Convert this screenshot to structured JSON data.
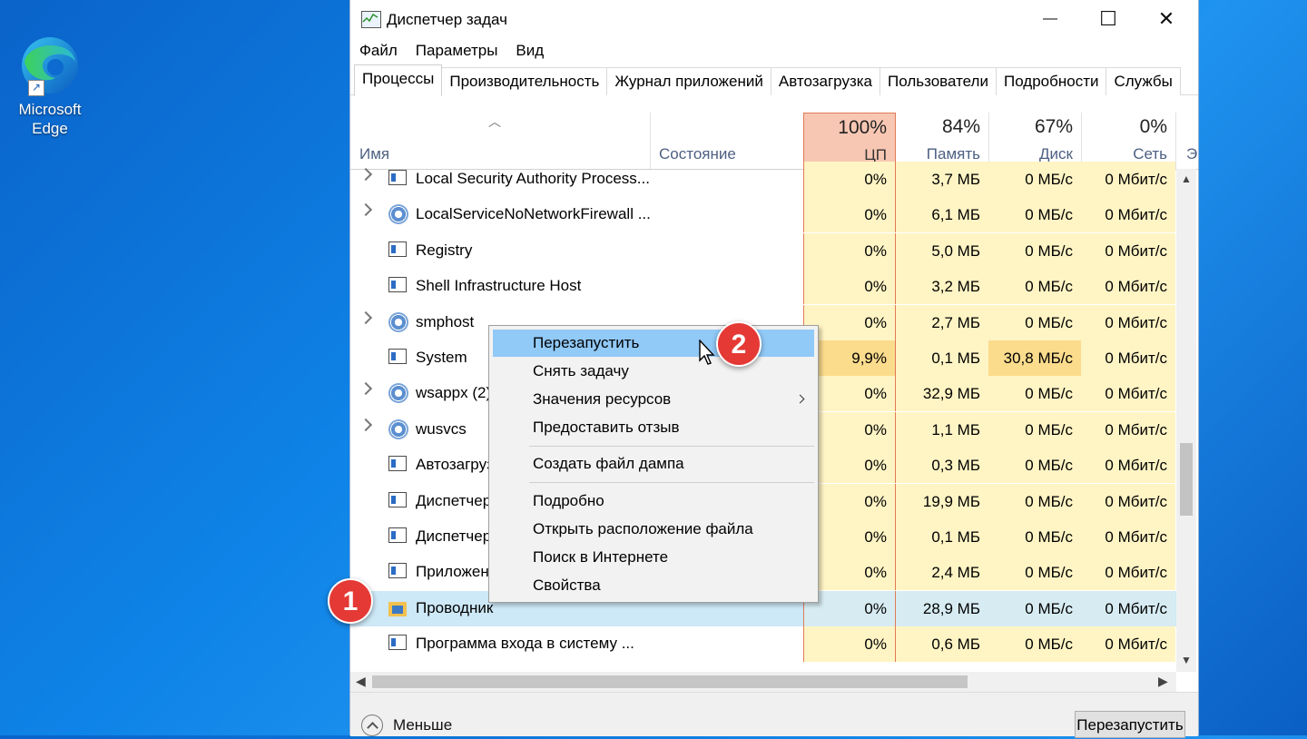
{
  "desktop": {
    "edge_label_line1": "Microsoft",
    "edge_label_line2": "Edge"
  },
  "window": {
    "title": "Диспетчер задач",
    "controls": {
      "minimize": "—",
      "maximize": "☐",
      "close": "✕"
    },
    "menu": [
      "Файл",
      "Параметры",
      "Вид"
    ],
    "tabs": [
      "Процессы",
      "Производительность",
      "Журнал приложений",
      "Автозагрузка",
      "Пользователи",
      "Подробности",
      "Службы"
    ],
    "active_tab": 0
  },
  "table": {
    "col_name": "Имя",
    "col_state": "Состояние",
    "cpu": {
      "pct": "100%",
      "label": "ЦП"
    },
    "mem": {
      "pct": "84%",
      "label": "Память"
    },
    "disk": {
      "pct": "67%",
      "label": "Диск"
    },
    "net": {
      "pct": "0%",
      "label": "Сеть"
    },
    "col_more": "Э",
    "rows": [
      {
        "name": "Local Security Authority Process...",
        "icon": "window",
        "expand": true,
        "cpu": "0%",
        "mem": "3,7 МБ",
        "disk": "0 МБ/с",
        "net": "0 Мбит/с"
      },
      {
        "name": "LocalServiceNoNetworkFirewall ...",
        "icon": "gear",
        "expand": true,
        "cpu": "0%",
        "mem": "6,1 МБ",
        "disk": "0 МБ/с",
        "net": "0 Мбит/с"
      },
      {
        "name": "Registry",
        "icon": "window",
        "expand": false,
        "cpu": "0%",
        "mem": "5,0 МБ",
        "disk": "0 МБ/с",
        "net": "0 Мбит/с"
      },
      {
        "name": "Shell Infrastructure Host",
        "icon": "window",
        "expand": false,
        "cpu": "0%",
        "mem": "3,2 МБ",
        "disk": "0 МБ/с",
        "net": "0 Мбит/с"
      },
      {
        "name": "smphost",
        "icon": "gear",
        "expand": true,
        "cpu": "0%",
        "mem": "2,7 МБ",
        "disk": "0 МБ/с",
        "net": "0 Мбит/с"
      },
      {
        "name": "System",
        "icon": "window",
        "expand": false,
        "cpu": "9,9%",
        "mem": "0,1 МБ",
        "disk": "30,8 МБ/с",
        "net": "0 Мбит/с",
        "hot_cpu": true,
        "hot_disk": true
      },
      {
        "name": "wsappx (2)",
        "icon": "gear",
        "expand": true,
        "cpu": "0%",
        "mem": "32,9 МБ",
        "disk": "0 МБ/с",
        "net": "0 Мбит/с"
      },
      {
        "name": "wusvcs",
        "icon": "gear",
        "expand": true,
        "cpu": "0%",
        "mem": "1,1 МБ",
        "disk": "0 МБ/с",
        "net": "0 Мбит/с"
      },
      {
        "name": "Автозагруз",
        "icon": "window",
        "expand": false,
        "cpu": "0%",
        "mem": "0,3 МБ",
        "disk": "0 МБ/с",
        "net": "0 Мбит/с"
      },
      {
        "name": "Диспетчер",
        "icon": "window",
        "expand": false,
        "cpu": "0%",
        "mem": "19,9 МБ",
        "disk": "0 МБ/с",
        "net": "0 Мбит/с"
      },
      {
        "name": "Диспетчер",
        "icon": "window",
        "expand": false,
        "cpu": "0%",
        "mem": "0,1 МБ",
        "disk": "0 МБ/с",
        "net": "0 Мбит/с"
      },
      {
        "name": "Приложен",
        "icon": "window",
        "expand": false,
        "cpu": "0%",
        "mem": "2,4 МБ",
        "disk": "0 МБ/с",
        "net": "0 Мбит/с"
      },
      {
        "name": "Проводник",
        "icon": "folder",
        "expand": false,
        "cpu": "0%",
        "mem": "28,9 МБ",
        "disk": "0 МБ/с",
        "net": "0 Мбит/с",
        "selected": true
      },
      {
        "name": "Программа входа в систему ...",
        "icon": "window",
        "expand": false,
        "cpu": "0%",
        "mem": "0,6 МБ",
        "disk": "0 МБ/с",
        "net": "0 Мбит/с"
      }
    ]
  },
  "footer": {
    "less_label": "Меньше",
    "restart_button": "Перезапустить"
  },
  "context_menu": {
    "items": [
      "Перезапустить",
      "Снять задачу",
      "Значения ресурсов",
      "Предоставить отзыв",
      "Создать файл дампа",
      "Подробно",
      "Открыть расположение файла",
      "Поиск в Интернете",
      "Свойства"
    ]
  },
  "badges": {
    "step1": "1",
    "step2": "2"
  },
  "colors": {
    "accent_cpu": "#e07a55",
    "heat": "#fff4c4",
    "hot": "#fbdc8d",
    "menu_highlight": "#91c9f7",
    "badge": "#e53935"
  }
}
